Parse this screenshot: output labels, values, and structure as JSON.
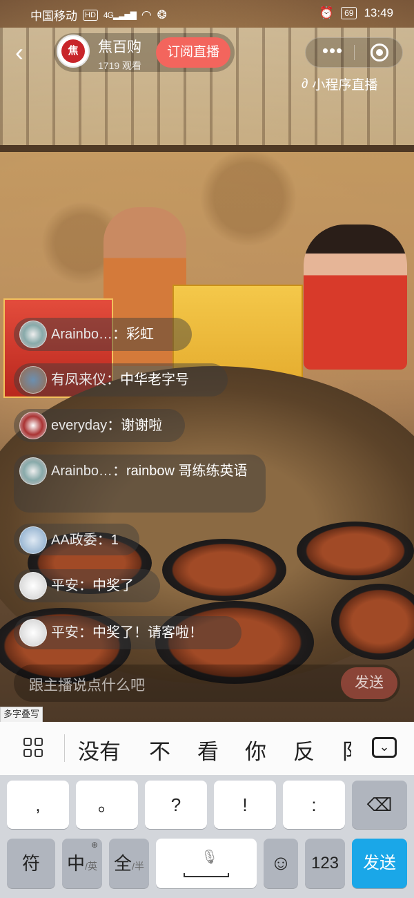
{
  "status_bar": {
    "carrier": "中国移动",
    "hd": "HD",
    "network": "4G",
    "battery": "69",
    "time": "13:49"
  },
  "header": {
    "anchor_name": "焦百购",
    "viewers": "1719 观看",
    "subscribe_label": "订阅直播",
    "mini_program_label": "小程序直播",
    "logo_text": "焦"
  },
  "comments": [
    {
      "name": "Arainbo…",
      "sep": "：",
      "text": "彩虹"
    },
    {
      "name": "有凤来仪",
      "sep": "：",
      "text": "中华老字号"
    },
    {
      "name": "everyday",
      "sep": "：",
      "text": "谢谢啦"
    },
    {
      "name": "Arainbo…",
      "sep": "：",
      "text": "rainbow 哥练练英语"
    },
    {
      "name": "AA政委",
      "sep": "：",
      "text": "1"
    },
    {
      "name": "平安",
      "sep": "：",
      "text": "中奖了"
    },
    {
      "name": "平安",
      "sep": "：",
      "text": "中奖了！请客啦！"
    }
  ],
  "input": {
    "placeholder": "跟主播说点什么吧",
    "send_label": "发送"
  },
  "overlay_tag": "多字叠写",
  "keyboard": {
    "candidates": [
      "没有",
      "不",
      "看",
      "你",
      "反",
      "阝"
    ],
    "row1": [
      ",",
      "。",
      "?",
      "!",
      ":"
    ],
    "row2": {
      "symbols": "符",
      "chinese": "中",
      "english_sub": "/英",
      "fullwidth": "全",
      "halfwidth_sub": "/半",
      "numbers": "123",
      "send": "发送"
    }
  },
  "colors": {
    "subscribe": "#f3655d",
    "send_key": "#1aa7e8"
  }
}
